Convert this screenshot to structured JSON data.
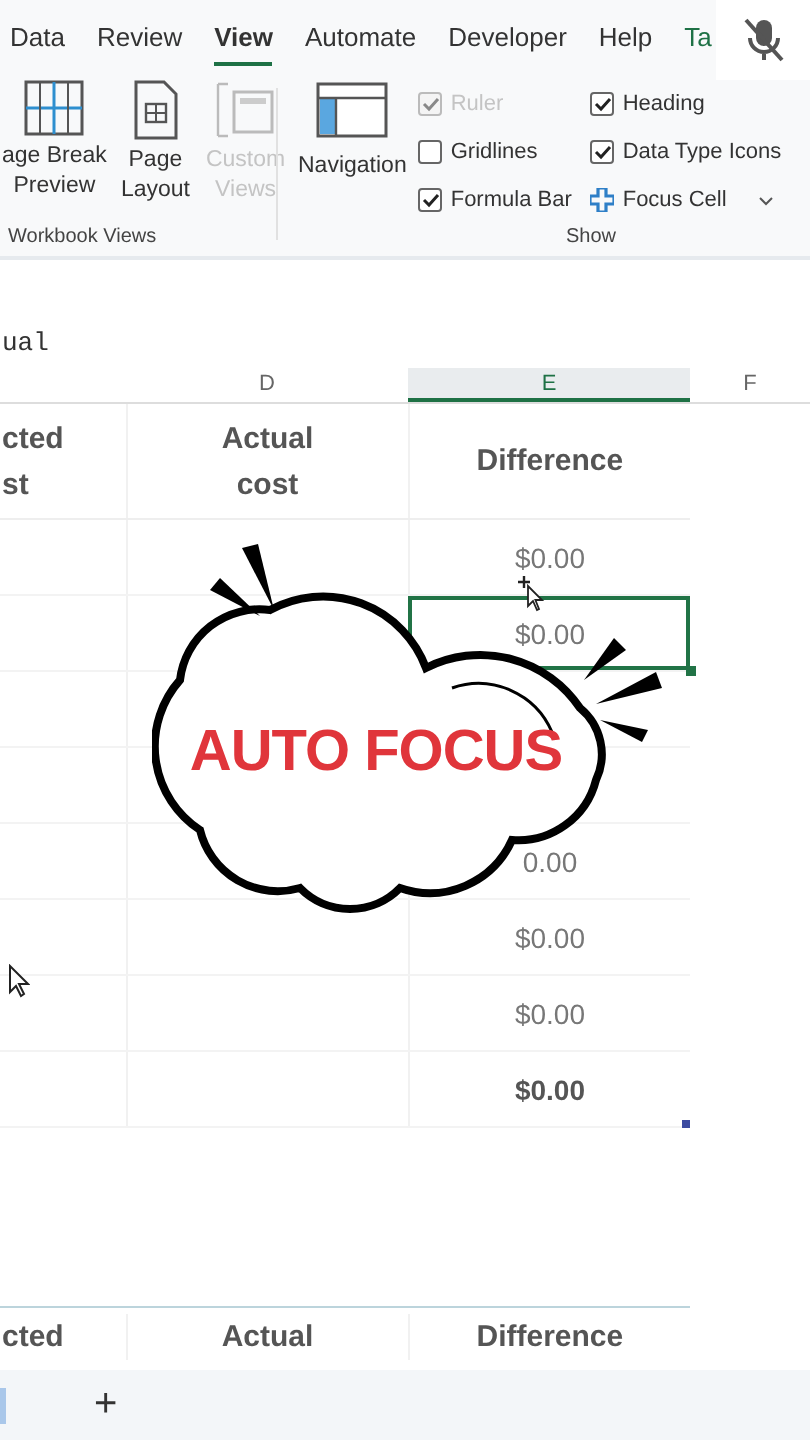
{
  "ribbon_tabs": [
    {
      "label": "Data",
      "selected": false,
      "kind": "standard"
    },
    {
      "label": "Review",
      "selected": false,
      "kind": "standard"
    },
    {
      "label": "View",
      "selected": true,
      "kind": "standard"
    },
    {
      "label": "Automate",
      "selected": false,
      "kind": "standard"
    },
    {
      "label": "Developer",
      "selected": false,
      "kind": "standard"
    },
    {
      "label": "Help",
      "selected": false,
      "kind": "standard"
    },
    {
      "label": "Ta",
      "selected": false,
      "kind": "contextual"
    }
  ],
  "workbook_views": {
    "label": "Workbook Views",
    "buttons": [
      {
        "label": "age Break\nPreview",
        "kind": "page-break",
        "disabled": false
      },
      {
        "label": "Page\nLayout",
        "kind": "page-layout",
        "disabled": false
      },
      {
        "label": "Custom\nViews",
        "kind": "custom-views",
        "disabled": true
      }
    ]
  },
  "show": {
    "label": "Show",
    "navigation": "Navigation",
    "options": [
      {
        "label": "Ruler",
        "kind": "checkbox",
        "checked": true,
        "disabled": true
      },
      {
        "label": "Gridlines",
        "kind": "checkbox",
        "checked": false,
        "disabled": false
      },
      {
        "label": "Formula Bar",
        "kind": "checkbox",
        "checked": true,
        "disabled": false
      },
      {
        "label": "Heading",
        "kind": "checkbox",
        "checked": true,
        "disabled": false
      },
      {
        "label": "Data Type Icons",
        "kind": "checkbox",
        "checked": true,
        "disabled": false
      },
      {
        "label": "Focus Cell",
        "kind": "button"
      }
    ]
  },
  "formula_bar": {
    "value": "ual"
  },
  "column_headers": [
    {
      "selected": false
    },
    {
      "label": "D",
      "selected": false
    },
    {
      "label": "E",
      "selected": true
    },
    {
      "label": "F",
      "selected": false
    }
  ],
  "table": {
    "header": [
      "cted\nst",
      "Actual\ncost",
      "Difference"
    ],
    "rows": [
      {
        "value": "$0.00",
        "selected": false,
        "kind": "normal"
      },
      {
        "value": "$0.00",
        "selected": true,
        "kind": "normal"
      },
      {
        "kind": "covered"
      },
      {
        "kind": "covered"
      },
      {
        "value": "0.00",
        "selected": false,
        "kind": "normal"
      },
      {
        "value": "$0.00",
        "selected": false,
        "kind": "normal"
      },
      {
        "value": "$0.00",
        "selected": false,
        "kind": "normal"
      },
      {
        "value": "$0.00",
        "selected": false,
        "kind": "total"
      }
    ]
  },
  "second_table": {
    "header": [
      "cted",
      "Actual",
      "Difference"
    ]
  },
  "overlay": {
    "text": "AUTO FOCUS"
  },
  "sheet_bar": {
    "add": "+"
  }
}
